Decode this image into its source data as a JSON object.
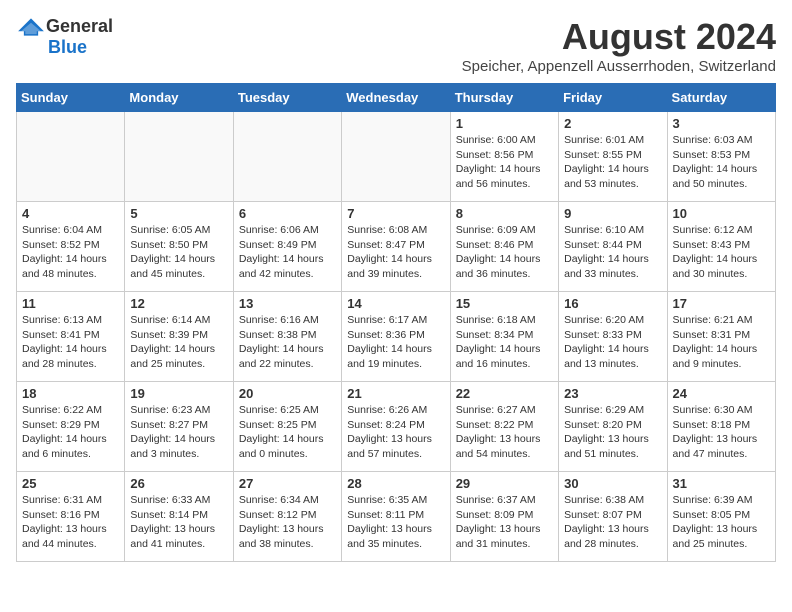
{
  "logo": {
    "general": "General",
    "blue": "Blue"
  },
  "title": {
    "month_year": "August 2024",
    "location": "Speicher, Appenzell Ausserrhoden, Switzerland"
  },
  "weekdays": [
    "Sunday",
    "Monday",
    "Tuesday",
    "Wednesday",
    "Thursday",
    "Friday",
    "Saturday"
  ],
  "days": [
    {
      "number": "",
      "info": ""
    },
    {
      "number": "",
      "info": ""
    },
    {
      "number": "",
      "info": ""
    },
    {
      "number": "",
      "info": ""
    },
    {
      "number": "1",
      "info": "Sunrise: 6:00 AM\nSunset: 8:56 PM\nDaylight: 14 hours\nand 56 minutes."
    },
    {
      "number": "2",
      "info": "Sunrise: 6:01 AM\nSunset: 8:55 PM\nDaylight: 14 hours\nand 53 minutes."
    },
    {
      "number": "3",
      "info": "Sunrise: 6:03 AM\nSunset: 8:53 PM\nDaylight: 14 hours\nand 50 minutes."
    },
    {
      "number": "4",
      "info": "Sunrise: 6:04 AM\nSunset: 8:52 PM\nDaylight: 14 hours\nand 48 minutes."
    },
    {
      "number": "5",
      "info": "Sunrise: 6:05 AM\nSunset: 8:50 PM\nDaylight: 14 hours\nand 45 minutes."
    },
    {
      "number": "6",
      "info": "Sunrise: 6:06 AM\nSunset: 8:49 PM\nDaylight: 14 hours\nand 42 minutes."
    },
    {
      "number": "7",
      "info": "Sunrise: 6:08 AM\nSunset: 8:47 PM\nDaylight: 14 hours\nand 39 minutes."
    },
    {
      "number": "8",
      "info": "Sunrise: 6:09 AM\nSunset: 8:46 PM\nDaylight: 14 hours\nand 36 minutes."
    },
    {
      "number": "9",
      "info": "Sunrise: 6:10 AM\nSunset: 8:44 PM\nDaylight: 14 hours\nand 33 minutes."
    },
    {
      "number": "10",
      "info": "Sunrise: 6:12 AM\nSunset: 8:43 PM\nDaylight: 14 hours\nand 30 minutes."
    },
    {
      "number": "11",
      "info": "Sunrise: 6:13 AM\nSunset: 8:41 PM\nDaylight: 14 hours\nand 28 minutes."
    },
    {
      "number": "12",
      "info": "Sunrise: 6:14 AM\nSunset: 8:39 PM\nDaylight: 14 hours\nand 25 minutes."
    },
    {
      "number": "13",
      "info": "Sunrise: 6:16 AM\nSunset: 8:38 PM\nDaylight: 14 hours\nand 22 minutes."
    },
    {
      "number": "14",
      "info": "Sunrise: 6:17 AM\nSunset: 8:36 PM\nDaylight: 14 hours\nand 19 minutes."
    },
    {
      "number": "15",
      "info": "Sunrise: 6:18 AM\nSunset: 8:34 PM\nDaylight: 14 hours\nand 16 minutes."
    },
    {
      "number": "16",
      "info": "Sunrise: 6:20 AM\nSunset: 8:33 PM\nDaylight: 14 hours\nand 13 minutes."
    },
    {
      "number": "17",
      "info": "Sunrise: 6:21 AM\nSunset: 8:31 PM\nDaylight: 14 hours\nand 9 minutes."
    },
    {
      "number": "18",
      "info": "Sunrise: 6:22 AM\nSunset: 8:29 PM\nDaylight: 14 hours\nand 6 minutes."
    },
    {
      "number": "19",
      "info": "Sunrise: 6:23 AM\nSunset: 8:27 PM\nDaylight: 14 hours\nand 3 minutes."
    },
    {
      "number": "20",
      "info": "Sunrise: 6:25 AM\nSunset: 8:25 PM\nDaylight: 14 hours\nand 0 minutes."
    },
    {
      "number": "21",
      "info": "Sunrise: 6:26 AM\nSunset: 8:24 PM\nDaylight: 13 hours\nand 57 minutes."
    },
    {
      "number": "22",
      "info": "Sunrise: 6:27 AM\nSunset: 8:22 PM\nDaylight: 13 hours\nand 54 minutes."
    },
    {
      "number": "23",
      "info": "Sunrise: 6:29 AM\nSunset: 8:20 PM\nDaylight: 13 hours\nand 51 minutes."
    },
    {
      "number": "24",
      "info": "Sunrise: 6:30 AM\nSunset: 8:18 PM\nDaylight: 13 hours\nand 47 minutes."
    },
    {
      "number": "25",
      "info": "Sunrise: 6:31 AM\nSunset: 8:16 PM\nDaylight: 13 hours\nand 44 minutes."
    },
    {
      "number": "26",
      "info": "Sunrise: 6:33 AM\nSunset: 8:14 PM\nDaylight: 13 hours\nand 41 minutes."
    },
    {
      "number": "27",
      "info": "Sunrise: 6:34 AM\nSunset: 8:12 PM\nDaylight: 13 hours\nand 38 minutes."
    },
    {
      "number": "28",
      "info": "Sunrise: 6:35 AM\nSunset: 8:11 PM\nDaylight: 13 hours\nand 35 minutes."
    },
    {
      "number": "29",
      "info": "Sunrise: 6:37 AM\nSunset: 8:09 PM\nDaylight: 13 hours\nand 31 minutes."
    },
    {
      "number": "30",
      "info": "Sunrise: 6:38 AM\nSunset: 8:07 PM\nDaylight: 13 hours\nand 28 minutes."
    },
    {
      "number": "31",
      "info": "Sunrise: 6:39 AM\nSunset: 8:05 PM\nDaylight: 13 hours\nand 25 minutes."
    }
  ]
}
